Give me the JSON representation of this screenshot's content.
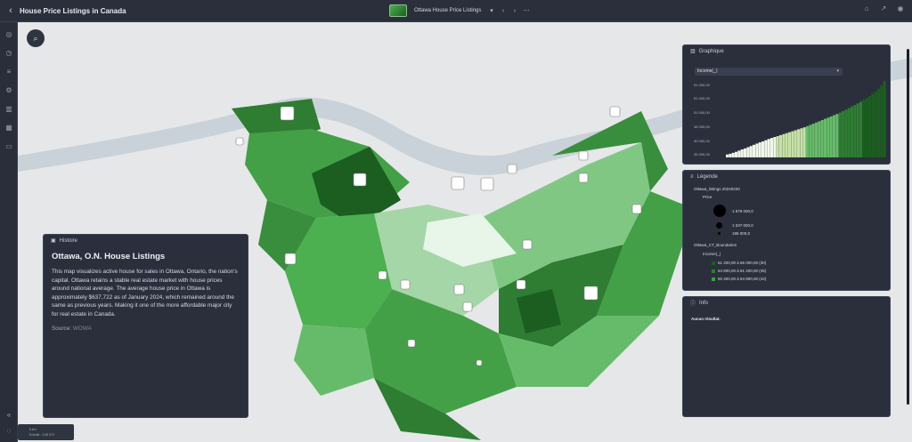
{
  "app": {
    "title": "House Price Listings in Canada",
    "map_name": "Ottawa House Price Listings",
    "overflow_icon": "more-horizontal-icon"
  },
  "colors": {
    "accent": "#2e7d32",
    "panel_bg": "#2b2f3c",
    "story_text": "#d7dae3"
  },
  "story": {
    "header": "Histoire",
    "title": "Ottawa, O.N. House Listings",
    "body": "This map visualizes active house for sales in Ottawa, Ontario, the nation's capital. Ottawa retains a stable real estate market with house prices around national average. The average house price in Ottawa is approximately $637,722 as of January 2024, which remained around the same as previous years. Making it one of the more affordable major city for real estate in Canada.",
    "source_label": "Source:",
    "source_value": "WOWA"
  },
  "graph": {
    "header": "Graphique",
    "field": "Income(_)",
    "axis_ticks": [
      "51 000,00",
      "51 000,00",
      "51 000,00",
      "45 000,00",
      "40 000,00",
      "35 000,00"
    ]
  },
  "legend": {
    "header": "Légende",
    "layer1": "Ottawa_listings 20240220",
    "layer1_field": "Price",
    "sizes": [
      "1 879 000,0",
      "1 037 000,0",
      "195 000,0"
    ],
    "layer2": "Ottawa_CT_Boundaries",
    "layer2_field": "Income(_)",
    "classes": [
      "61 200,00 à 66 000,00 (30)",
      "54 800,00 à 61 200,00 (45)",
      "50 400,00 à 54 800,00 (44)"
    ]
  },
  "info": {
    "header": "Info",
    "message": "Aucun résultat."
  },
  "scale": {
    "line1": "5 km",
    "line2": "Echelle : 1:59 972"
  },
  "chart_data": {
    "type": "bar",
    "values": [
      35200,
      35500,
      35900,
      36300,
      36800,
      37300,
      37700,
      38200,
      38700,
      39200,
      39700,
      40200,
      40600,
      41100,
      41600,
      42000,
      42400,
      42800,
      43200,
      43600,
      44000,
      44400,
      44800,
      45200,
      45600,
      46000,
      46400,
      46900,
      47400,
      47900,
      48400,
      48900,
      49400,
      49900,
      50400,
      50900,
      51400,
      51900,
      52500,
      53100,
      53700,
      54300,
      55000,
      55600,
      56300,
      57000,
      57800,
      58500,
      59300,
      60200,
      61100,
      62200,
      63600,
      65500
    ],
    "ylim": [
      34000,
      67000
    ]
  }
}
